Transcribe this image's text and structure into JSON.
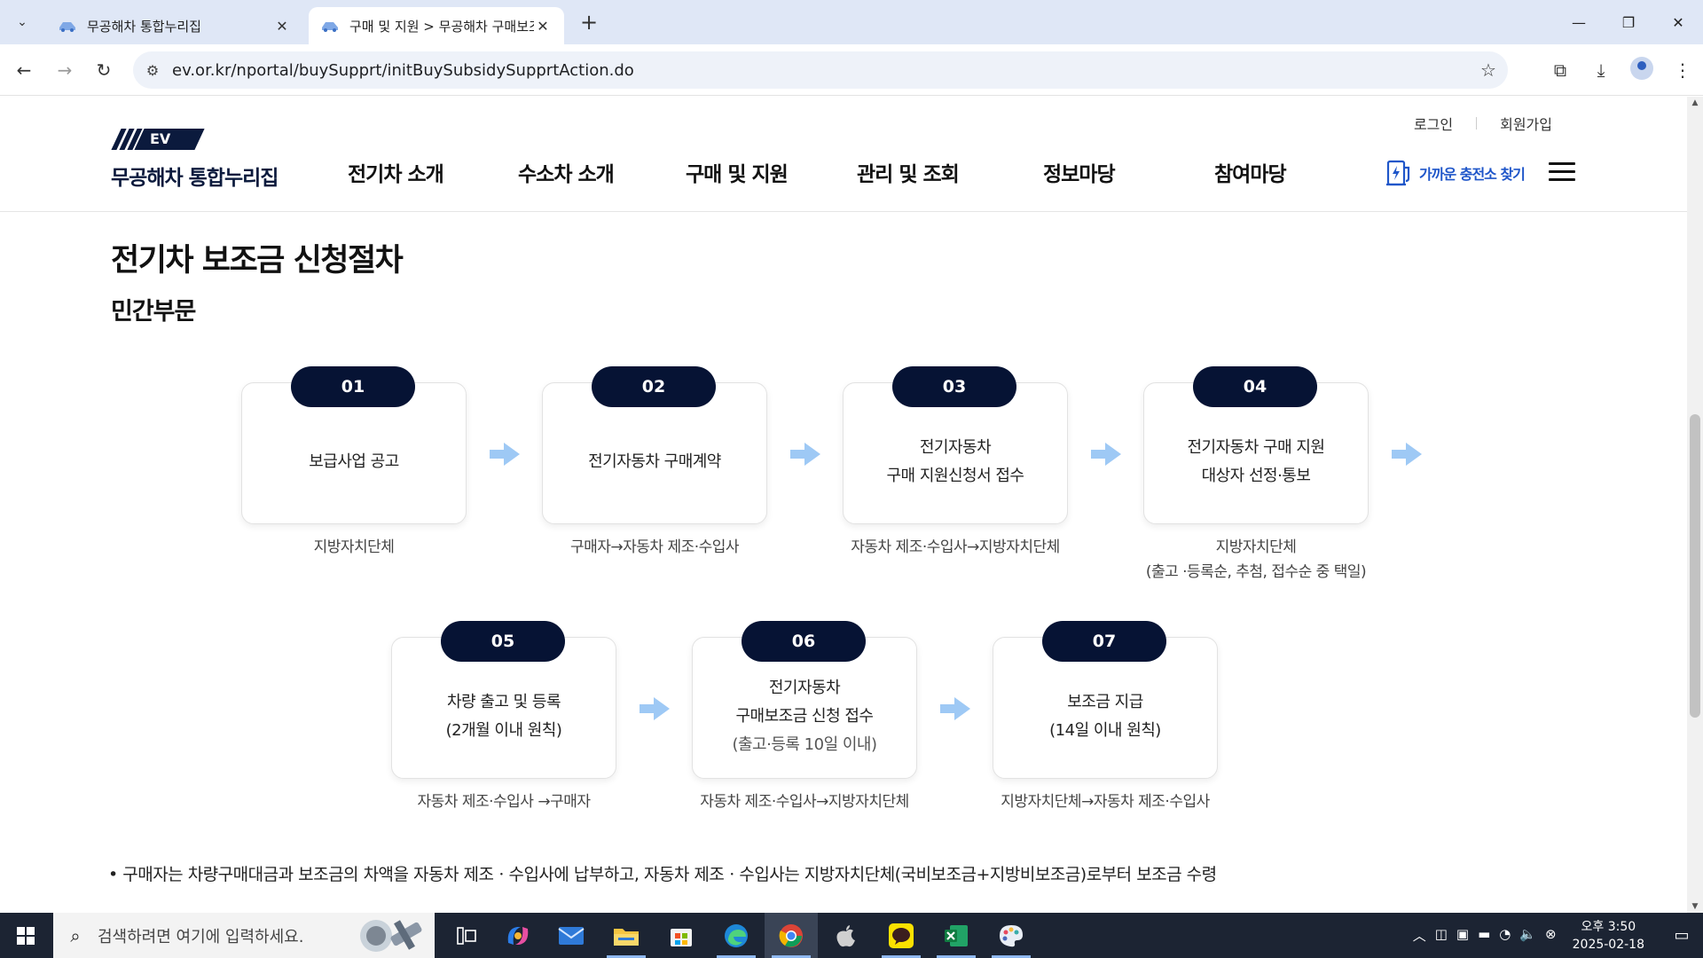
{
  "browser": {
    "tabs": [
      {
        "title": "무공해차 통합누리집",
        "active": false
      },
      {
        "title": "구매 및 지원 > 무공해차 구매보조금",
        "active": true
      }
    ],
    "url": "ev.or.kr/nportal/buySupprt/initBuySubsidySupprtAction.do"
  },
  "site": {
    "logo_mark": "EV",
    "logo_name": "무공해차 통합누리집",
    "util": {
      "login": "로그인",
      "signup": "회원가입"
    },
    "nav": [
      "전기차 소개",
      "수소차 소개",
      "구매 및 지원",
      "관리 및 조회",
      "정보마당",
      "참여마당"
    ],
    "charge_button": "가까운 충전소 찾기"
  },
  "content": {
    "title": "전기차 보조금 신청절차",
    "subtitle": "민간부문",
    "steps": [
      {
        "num": "01",
        "lines": [
          "보급사업 공고"
        ],
        "who": [
          "지방자치단체"
        ]
      },
      {
        "num": "02",
        "lines": [
          "전기자동차 구매계약"
        ],
        "who": [
          "구매자→자동차 제조·수입사"
        ]
      },
      {
        "num": "03",
        "lines": [
          "전기자동차",
          "구매 지원신청서 접수"
        ],
        "who": [
          "자동차 제조·수입사→지방자치단체"
        ]
      },
      {
        "num": "04",
        "lines": [
          "전기자동차 구매 지원",
          "대상자 선정·통보"
        ],
        "who": [
          "지방자치단체",
          "(출고 ·등록순, 추첨, 접수순 중 택일)"
        ]
      },
      {
        "num": "05",
        "lines": [
          "차량 출고 및 등록",
          "(2개월 이내 원칙)"
        ],
        "who": [
          "자동차 제조·수입사 →구매자"
        ]
      },
      {
        "num": "06",
        "lines": [
          "전기자동차",
          "구매보조금 신청 접수",
          "(출고·등록 10일 이내)"
        ],
        "who": [
          "자동차 제조·수입사→지방자치단체"
        ]
      },
      {
        "num": "07",
        "lines": [
          "보조금 지급",
          "(14일 이내 원칙)"
        ],
        "who": [
          "지방자치단체→자동차 제조·수입사"
        ]
      }
    ],
    "note": "• 구매자는 차량구매대금과 보조금의 차액을 자동차 제조ㆍ수입사에 납부하고, 자동차 제조ㆍ수입사는 지방자치단체(국비보조금+지방비보조금)로부터 보조금 수령"
  },
  "taskbar": {
    "search_placeholder": "검색하려면 여기에 입력하세요.",
    "time": "오후 3:50",
    "date": "2025-02-18"
  },
  "colors": {
    "navy": "#061334",
    "brand_blue": "#1f56c9",
    "arrow_blue": "#9ec9f5"
  }
}
